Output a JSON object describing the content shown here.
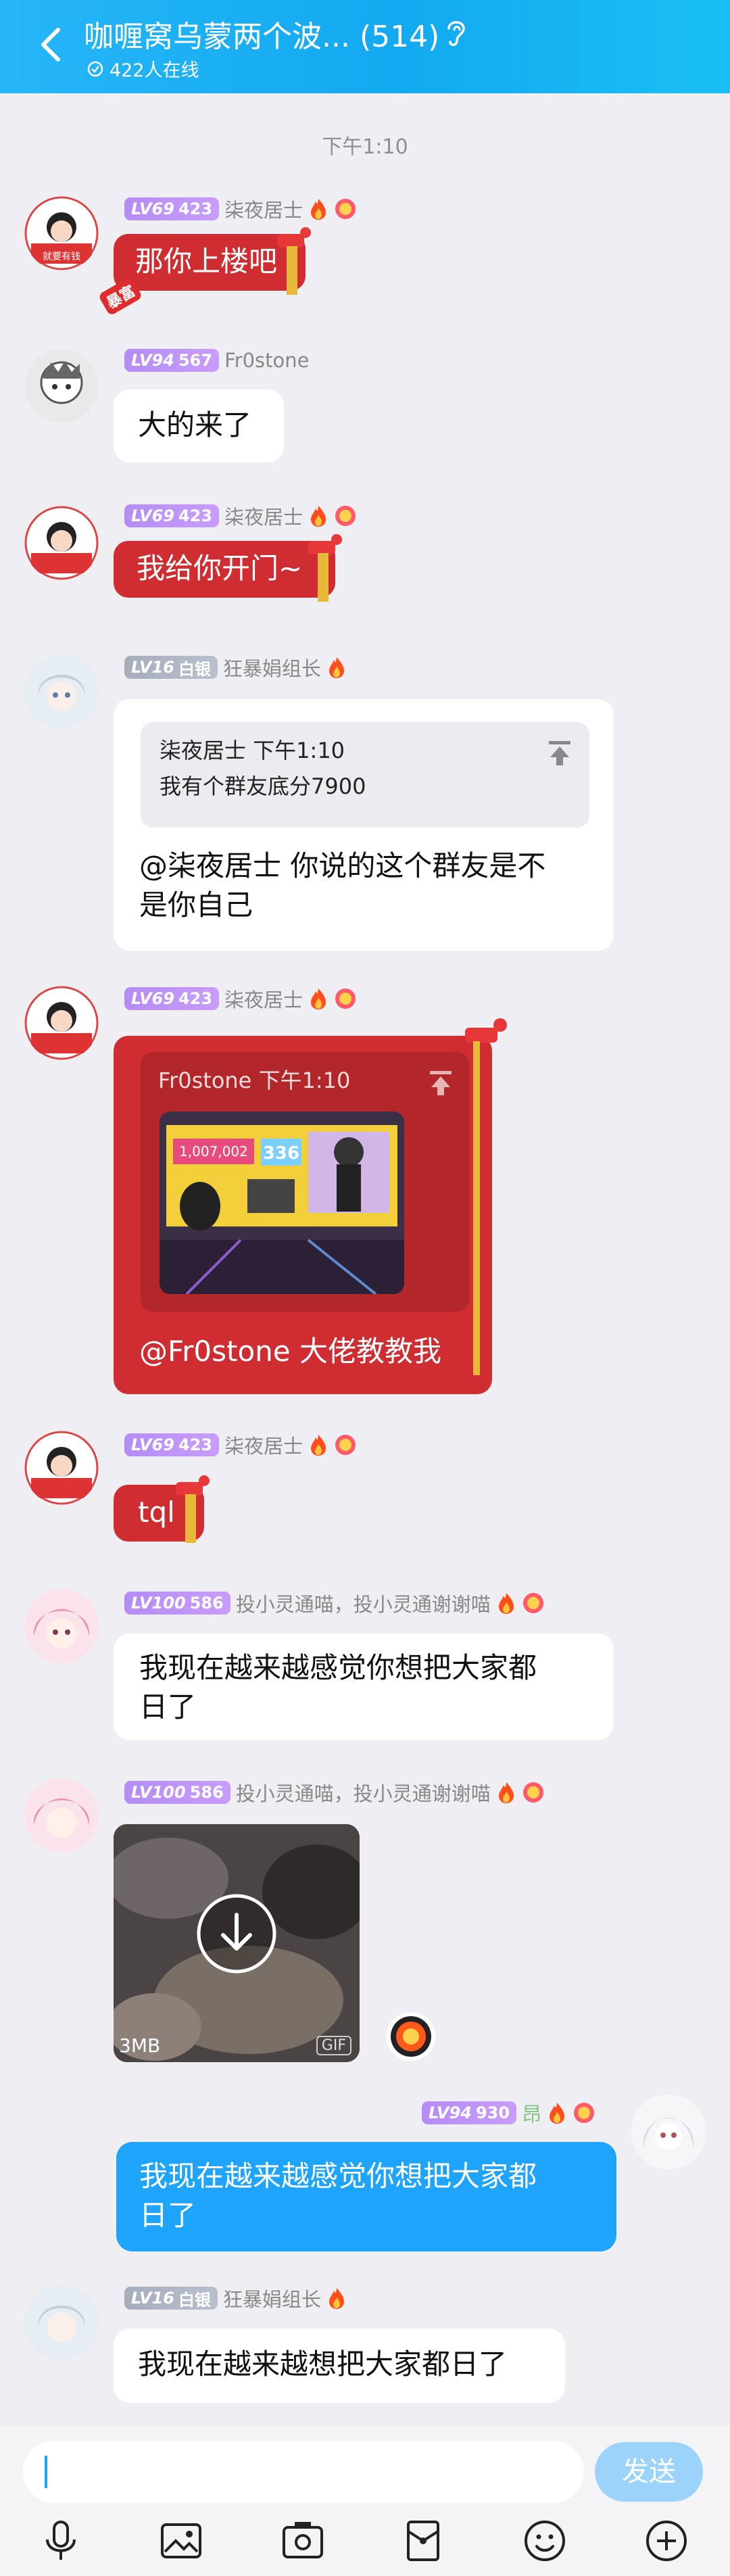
{
  "header": {
    "title": "咖喱窝乌蒙两个波...  (514)",
    "online": "422人在线"
  },
  "time_separator": "下午1:10",
  "messages": [
    {
      "level": "LV69",
      "points": "423",
      "name": "柒夜居士",
      "text": "那你上楼吧"
    },
    {
      "level": "LV94",
      "points": "567",
      "name": "Fr0stone",
      "text": "大的来了"
    },
    {
      "level": "LV69",
      "points": "423",
      "name": "柒夜居士",
      "text": "我给你开门~"
    },
    {
      "level": "LV16",
      "points": "白银",
      "name": "狂暴娟组长",
      "quote_head": "柒夜居士 下午1:10",
      "quote_body": "我有个群友底分7900",
      "text_line1": "@柒夜居士 你说的这个群友是不",
      "text_line2": "是你自己"
    },
    {
      "level": "LV69",
      "points": "423",
      "name": "柒夜居士",
      "quote_head": "Fr0stone 下午1:10",
      "score_left": "1,007,002",
      "score_right": "336",
      "text": "@Fr0stone 大佬教教我"
    },
    {
      "level": "LV69",
      "points": "423",
      "name": "柒夜居士",
      "text": "tql"
    },
    {
      "level": "LV100",
      "points": "586",
      "name": "投小灵通喵，投小灵通谢谢喵",
      "text_line1": "我现在越来越感觉你想把大家都",
      "text_line2": "日了"
    },
    {
      "level": "LV100",
      "points": "586",
      "name": "投小灵通喵，投小灵通谢谢喵",
      "size": "3MB",
      "gif": "GIF"
    },
    {
      "level": "LV94",
      "points": "930",
      "name": "昂",
      "text_line1": "我现在越来越感觉你想把大家都",
      "text_line2": "日了"
    },
    {
      "level": "LV16",
      "points": "白银",
      "name": "狂暴娟组长",
      "text": "我现在越来越想把大家都日了"
    }
  ],
  "avatar_tag": "就要有钱",
  "lantern_tag": "暴富",
  "input": {
    "placeholder": "",
    "send": "发送"
  },
  "toolbar": [
    "microphone-icon",
    "image-icon",
    "camera-icon",
    "red-packet-icon",
    "emoji-icon",
    "plus-icon"
  ],
  "colors": {
    "header": "#1aaff2",
    "red_bubble": "#cf2d32",
    "blue_bubble": "#1ea4fb",
    "level_purple": "#b58cf5"
  }
}
